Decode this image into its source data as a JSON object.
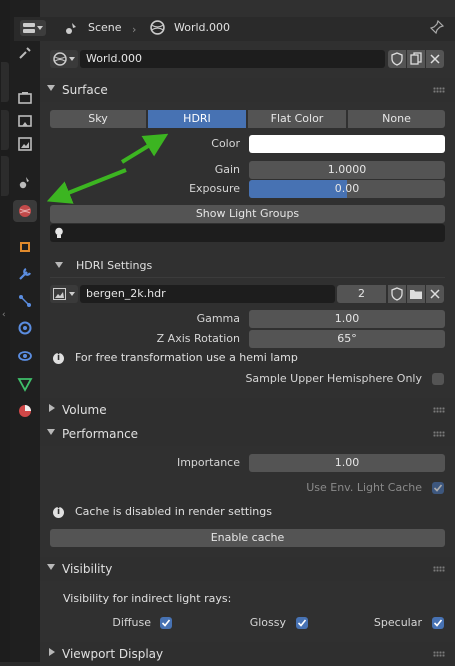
{
  "header": {
    "scene_label": "Scene",
    "world_label": "World.000"
  },
  "world_selector": {
    "name": "World.000"
  },
  "surface": {
    "title": "Surface",
    "tabs": [
      "Sky",
      "HDRI",
      "Flat Color",
      "None"
    ],
    "active_tab": "HDRI",
    "color_label": "Color",
    "gain_label": "Gain",
    "gain_value": "1.0000",
    "exposure_label": "Exposure",
    "exposure_value": "0.00",
    "show_light_groups": "Show Light Groups"
  },
  "hdri": {
    "title": "HDRI Settings",
    "image_name": "bergen_2k.hdr",
    "users": "2",
    "gamma_label": "Gamma",
    "gamma_value": "1.00",
    "zrot_label": "Z Axis Rotation",
    "zrot_value": "65°",
    "info_text": "For free transformation use a hemi lamp",
    "sample_upper_label": "Sample Upper Hemisphere Only",
    "sample_upper_checked": false
  },
  "volume": {
    "title": "Volume"
  },
  "performance": {
    "title": "Performance",
    "importance_label": "Importance",
    "importance_value": "1.00",
    "use_env_label": "Use Env. Light Cache",
    "use_env_checked": true,
    "cache_info": "Cache is disabled in render settings",
    "enable_cache": "Enable cache"
  },
  "visibility": {
    "title": "Visibility",
    "indirect_label": "Visibility for indirect light rays:",
    "diffuse_label": "Diffuse",
    "glossy_label": "Glossy",
    "specular_label": "Specular"
  },
  "viewport_display": {
    "title": "Viewport Display"
  },
  "colors": {
    "accent": "#4772b3",
    "arrow": "#3cb521",
    "background": "#303030"
  }
}
